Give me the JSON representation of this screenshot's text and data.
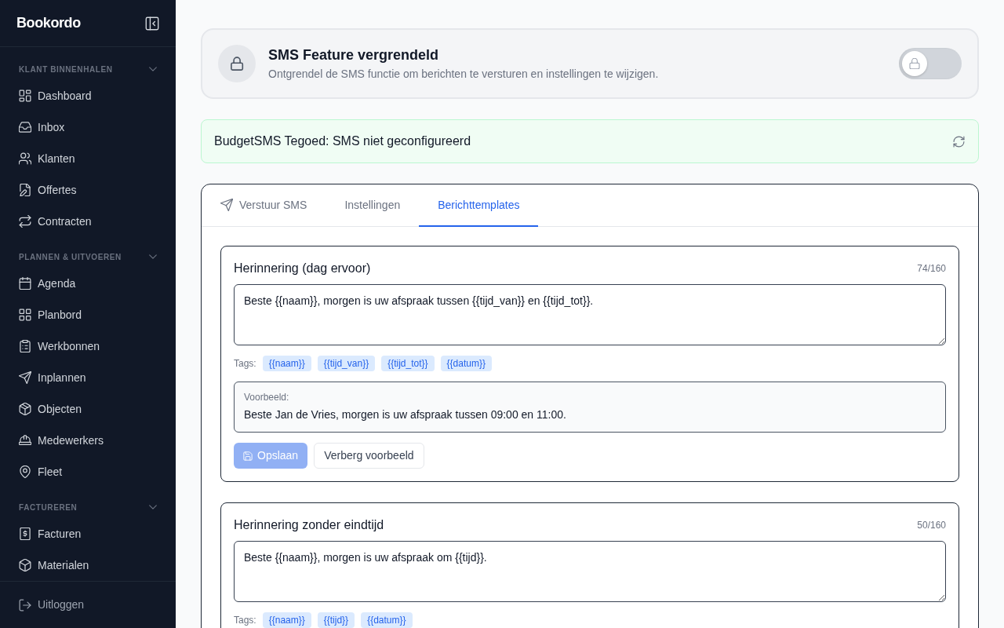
{
  "sidebar": {
    "logo": "Bookordo",
    "sections": [
      {
        "title": "KLANT BINNENHALEN",
        "expanded": true,
        "items": [
          {
            "label": "Dashboard"
          },
          {
            "label": "Inbox"
          },
          {
            "label": "Klanten"
          },
          {
            "label": "Offertes"
          },
          {
            "label": "Contracten"
          }
        ]
      },
      {
        "title": "PLANNEN & UITVOEREN",
        "expanded": true,
        "items": [
          {
            "label": "Agenda"
          },
          {
            "label": "Planbord"
          },
          {
            "label": "Werkbonnen"
          },
          {
            "label": "Inplannen"
          },
          {
            "label": "Objecten"
          },
          {
            "label": "Medewerkers"
          },
          {
            "label": "Fleet"
          }
        ]
      },
      {
        "title": "FACTUREREN",
        "expanded": true,
        "items": [
          {
            "label": "Facturen"
          },
          {
            "label": "Materialen"
          }
        ]
      }
    ],
    "logout": {
      "label": "Uitloggen"
    }
  },
  "lock_card": {
    "title": "SMS Feature vergrendeld",
    "subtitle": "Ontgrendel de SMS functie om berichten te versturen en instellingen te wijzigen.",
    "toggle": {
      "on": false
    }
  },
  "balance_alert": {
    "text": "BudgetSMS Tegoed: SMS niet geconfigureerd"
  },
  "tabs": [
    {
      "label": "Verstuur SMS",
      "selected": false
    },
    {
      "label": "Instellingen",
      "selected": false
    },
    {
      "label": "Berichttemplates",
      "selected": true
    }
  ],
  "templates": [
    {
      "title": "Herinnering (dag ervoor)",
      "count": "74/160",
      "value": "Beste {{naam}}, morgen is uw afspraak tussen {{tijd_van}} en {{tijd_tot}}.",
      "tags_label": "Tags:",
      "tags": [
        "{{naam}}",
        "{{tijd_van}}",
        "{{tijd_tot}}",
        "{{datum}}"
      ],
      "preview": {
        "label": "Voorbeeld:",
        "text": "Beste Jan de Vries, morgen is uw afspraak tussen 09:00 en 11:00."
      },
      "buttons": [
        {
          "kind": "save",
          "label": "Opslaan",
          "disabled": true
        },
        {
          "kind": "toggle_preview",
          "label": "Verberg voorbeeld",
          "disabled": false
        }
      ]
    },
    {
      "title": "Herinnering zonder eindtijd",
      "count": "50/160",
      "value": "Beste {{naam}}, morgen is uw afspraak om {{tijd}}.",
      "tags_label": "Tags:",
      "tags": [
        "{{naam}}",
        "{{tijd}}",
        "{{datum}}"
      ]
    }
  ]
}
